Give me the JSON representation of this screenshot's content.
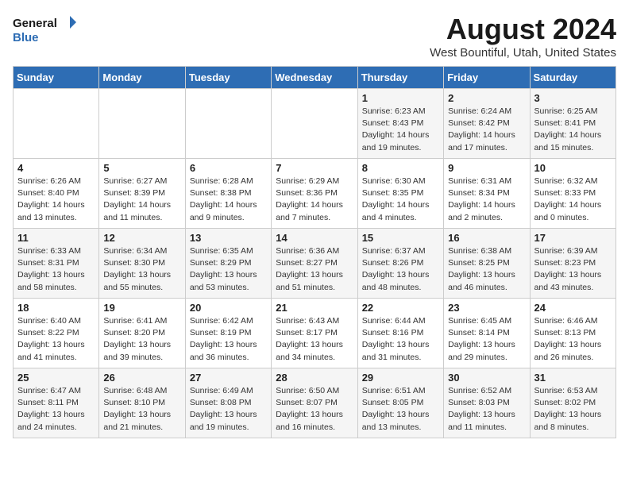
{
  "logo": {
    "line1": "General",
    "line2": "Blue"
  },
  "title": "August 2024",
  "location": "West Bountiful, Utah, United States",
  "weekdays": [
    "Sunday",
    "Monday",
    "Tuesday",
    "Wednesday",
    "Thursday",
    "Friday",
    "Saturday"
  ],
  "weeks": [
    [
      {
        "day": "",
        "info": ""
      },
      {
        "day": "",
        "info": ""
      },
      {
        "day": "",
        "info": ""
      },
      {
        "day": "",
        "info": ""
      },
      {
        "day": "1",
        "info": "Sunrise: 6:23 AM\nSunset: 8:43 PM\nDaylight: 14 hours\nand 19 minutes."
      },
      {
        "day": "2",
        "info": "Sunrise: 6:24 AM\nSunset: 8:42 PM\nDaylight: 14 hours\nand 17 minutes."
      },
      {
        "day": "3",
        "info": "Sunrise: 6:25 AM\nSunset: 8:41 PM\nDaylight: 14 hours\nand 15 minutes."
      }
    ],
    [
      {
        "day": "4",
        "info": "Sunrise: 6:26 AM\nSunset: 8:40 PM\nDaylight: 14 hours\nand 13 minutes."
      },
      {
        "day": "5",
        "info": "Sunrise: 6:27 AM\nSunset: 8:39 PM\nDaylight: 14 hours\nand 11 minutes."
      },
      {
        "day": "6",
        "info": "Sunrise: 6:28 AM\nSunset: 8:38 PM\nDaylight: 14 hours\nand 9 minutes."
      },
      {
        "day": "7",
        "info": "Sunrise: 6:29 AM\nSunset: 8:36 PM\nDaylight: 14 hours\nand 7 minutes."
      },
      {
        "day": "8",
        "info": "Sunrise: 6:30 AM\nSunset: 8:35 PM\nDaylight: 14 hours\nand 4 minutes."
      },
      {
        "day": "9",
        "info": "Sunrise: 6:31 AM\nSunset: 8:34 PM\nDaylight: 14 hours\nand 2 minutes."
      },
      {
        "day": "10",
        "info": "Sunrise: 6:32 AM\nSunset: 8:33 PM\nDaylight: 14 hours\nand 0 minutes."
      }
    ],
    [
      {
        "day": "11",
        "info": "Sunrise: 6:33 AM\nSunset: 8:31 PM\nDaylight: 13 hours\nand 58 minutes."
      },
      {
        "day": "12",
        "info": "Sunrise: 6:34 AM\nSunset: 8:30 PM\nDaylight: 13 hours\nand 55 minutes."
      },
      {
        "day": "13",
        "info": "Sunrise: 6:35 AM\nSunset: 8:29 PM\nDaylight: 13 hours\nand 53 minutes."
      },
      {
        "day": "14",
        "info": "Sunrise: 6:36 AM\nSunset: 8:27 PM\nDaylight: 13 hours\nand 51 minutes."
      },
      {
        "day": "15",
        "info": "Sunrise: 6:37 AM\nSunset: 8:26 PM\nDaylight: 13 hours\nand 48 minutes."
      },
      {
        "day": "16",
        "info": "Sunrise: 6:38 AM\nSunset: 8:25 PM\nDaylight: 13 hours\nand 46 minutes."
      },
      {
        "day": "17",
        "info": "Sunrise: 6:39 AM\nSunset: 8:23 PM\nDaylight: 13 hours\nand 43 minutes."
      }
    ],
    [
      {
        "day": "18",
        "info": "Sunrise: 6:40 AM\nSunset: 8:22 PM\nDaylight: 13 hours\nand 41 minutes."
      },
      {
        "day": "19",
        "info": "Sunrise: 6:41 AM\nSunset: 8:20 PM\nDaylight: 13 hours\nand 39 minutes."
      },
      {
        "day": "20",
        "info": "Sunrise: 6:42 AM\nSunset: 8:19 PM\nDaylight: 13 hours\nand 36 minutes."
      },
      {
        "day": "21",
        "info": "Sunrise: 6:43 AM\nSunset: 8:17 PM\nDaylight: 13 hours\nand 34 minutes."
      },
      {
        "day": "22",
        "info": "Sunrise: 6:44 AM\nSunset: 8:16 PM\nDaylight: 13 hours\nand 31 minutes."
      },
      {
        "day": "23",
        "info": "Sunrise: 6:45 AM\nSunset: 8:14 PM\nDaylight: 13 hours\nand 29 minutes."
      },
      {
        "day": "24",
        "info": "Sunrise: 6:46 AM\nSunset: 8:13 PM\nDaylight: 13 hours\nand 26 minutes."
      }
    ],
    [
      {
        "day": "25",
        "info": "Sunrise: 6:47 AM\nSunset: 8:11 PM\nDaylight: 13 hours\nand 24 minutes."
      },
      {
        "day": "26",
        "info": "Sunrise: 6:48 AM\nSunset: 8:10 PM\nDaylight: 13 hours\nand 21 minutes."
      },
      {
        "day": "27",
        "info": "Sunrise: 6:49 AM\nSunset: 8:08 PM\nDaylight: 13 hours\nand 19 minutes."
      },
      {
        "day": "28",
        "info": "Sunrise: 6:50 AM\nSunset: 8:07 PM\nDaylight: 13 hours\nand 16 minutes."
      },
      {
        "day": "29",
        "info": "Sunrise: 6:51 AM\nSunset: 8:05 PM\nDaylight: 13 hours\nand 13 minutes."
      },
      {
        "day": "30",
        "info": "Sunrise: 6:52 AM\nSunset: 8:03 PM\nDaylight: 13 hours\nand 11 minutes."
      },
      {
        "day": "31",
        "info": "Sunrise: 6:53 AM\nSunset: 8:02 PM\nDaylight: 13 hours\nand 8 minutes."
      }
    ]
  ]
}
